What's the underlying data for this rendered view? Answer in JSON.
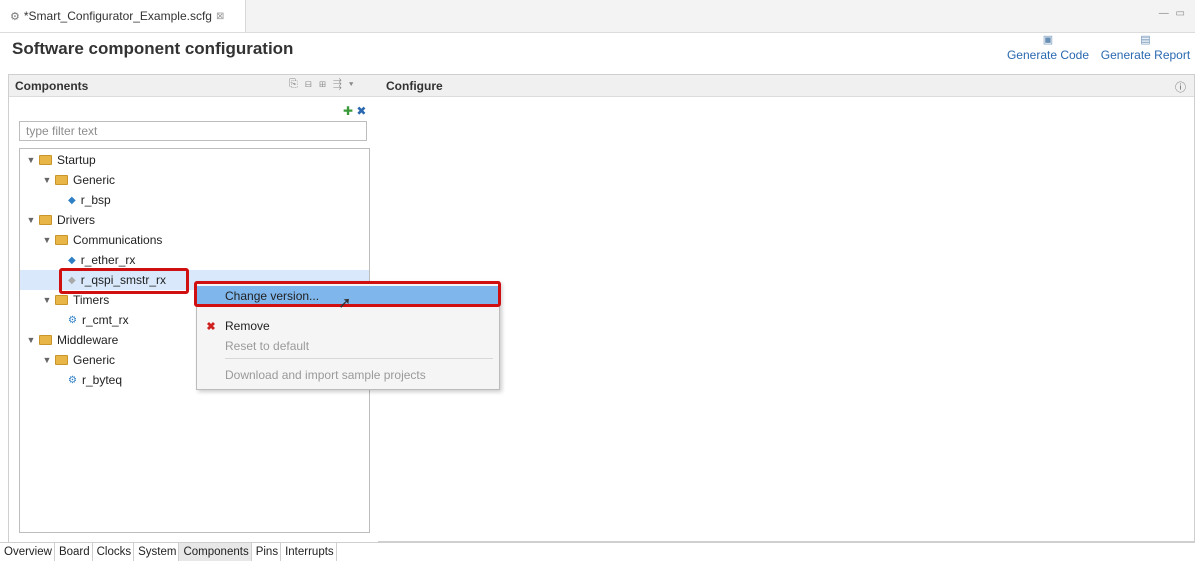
{
  "editor_tab": {
    "icon": "gear-icon",
    "title": "*Smart_Configurator_Example.scfg",
    "close": "⊠"
  },
  "header": {
    "title": "Software component configuration",
    "generate_code": "Generate Code",
    "generate_report": "Generate Report"
  },
  "components_panel": {
    "title": "Components",
    "filter_placeholder": "type filter text",
    "tree": [
      {
        "label": "Startup",
        "kind": "folder"
      },
      {
        "label": "Generic",
        "kind": "folder"
      },
      {
        "label": "r_bsp",
        "kind": "component"
      },
      {
        "label": "Drivers",
        "kind": "folder"
      },
      {
        "label": "Communications",
        "kind": "folder"
      },
      {
        "label": "r_ether_rx",
        "kind": "component"
      },
      {
        "label": "r_qspi_smstr_rx",
        "kind": "component",
        "selected": true
      },
      {
        "label": "Timers",
        "kind": "folder"
      },
      {
        "label": "r_cmt_rx",
        "kind": "component"
      },
      {
        "label": "Middleware",
        "kind": "folder"
      },
      {
        "label": "Generic",
        "kind": "folder"
      },
      {
        "label": "r_byteq",
        "kind": "component"
      }
    ]
  },
  "configure_panel": {
    "title": "Configure"
  },
  "context_menu": {
    "items": [
      {
        "label": "Change version...",
        "state": "highlighted"
      },
      {
        "label": "Remove",
        "icon": "red-x-icon"
      },
      {
        "label": "Reset to default",
        "state": "disabled"
      },
      {
        "label": "Download and import sample projects",
        "state": "disabled"
      }
    ]
  },
  "bottom_tabs": [
    "Overview",
    "Board",
    "Clocks",
    "System",
    "Components",
    "Pins",
    "Interrupts"
  ],
  "active_bottom_tab": "Components",
  "colors": {
    "highlight_box": "#d01010",
    "menu_active": "#7fb6ec",
    "link": "#2a69b0"
  }
}
